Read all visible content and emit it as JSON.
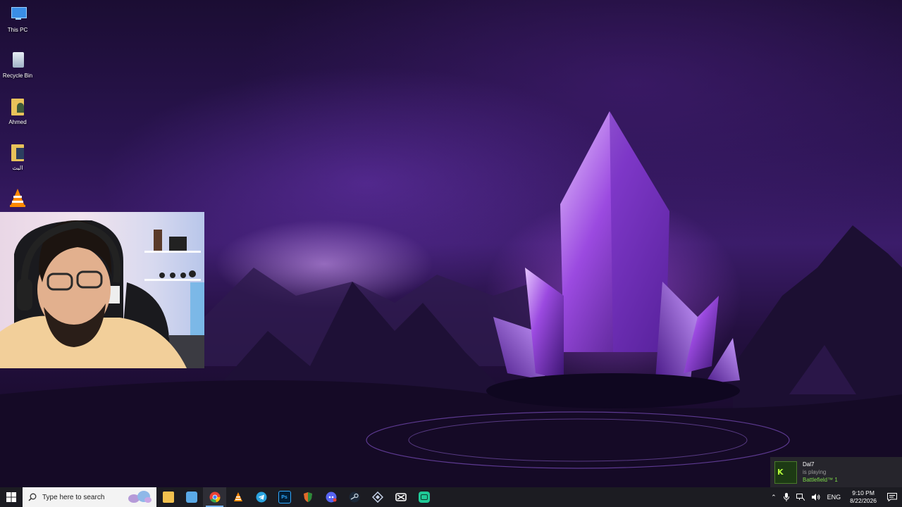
{
  "desktop": {
    "icons": [
      {
        "label": "This PC",
        "icon": "this-pc-icon"
      },
      {
        "label": "Recycle Bin",
        "icon": "recycle-bin-icon"
      },
      {
        "label": "Ahmed",
        "icon": "user-folder-icon"
      },
      {
        "label": "البث",
        "icon": "folder-icon"
      },
      {
        "label": "",
        "icon": "vlc-icon"
      }
    ]
  },
  "taskbar": {
    "search_placeholder": "Type here to search",
    "apps": [
      {
        "name": "File Explorer",
        "icon": "file-explorer-icon",
        "color": "#f2c14e"
      },
      {
        "name": "Task View Desktop",
        "icon": "desktop-icon",
        "color": "#5aa9e6"
      },
      {
        "name": "Google Chrome",
        "icon": "chrome-icon",
        "color": "#e94235",
        "active": true
      },
      {
        "name": "VLC",
        "icon": "vlc-icon",
        "color": "#ff8800"
      },
      {
        "name": "Telegram",
        "icon": "telegram-icon",
        "color": "#2aa3df"
      },
      {
        "name": "Photoshop",
        "icon": "photoshop-icon",
        "color": "#31a8ff"
      },
      {
        "name": "Shield App",
        "icon": "shield-icon",
        "color": "#e06a2a"
      },
      {
        "name": "Discord",
        "icon": "discord-icon",
        "color": "#5865f2"
      },
      {
        "name": "Steam",
        "icon": "steam-icon",
        "color": "#1b6aa8"
      },
      {
        "name": "Diamond App",
        "icon": "diamond-icon",
        "color": "#8aa0c8"
      },
      {
        "name": "CapCut",
        "icon": "capcut-icon",
        "color": "#ffffff"
      },
      {
        "name": "Green App",
        "icon": "green-app-icon",
        "color": "#20c997"
      }
    ],
    "tray": {
      "language": "ENG",
      "time": "9:10 PM",
      "date": "8/22/2026"
    }
  },
  "notification": {
    "user": "Dal7",
    "status": "is playing",
    "game": "Battlefield™ 1"
  }
}
